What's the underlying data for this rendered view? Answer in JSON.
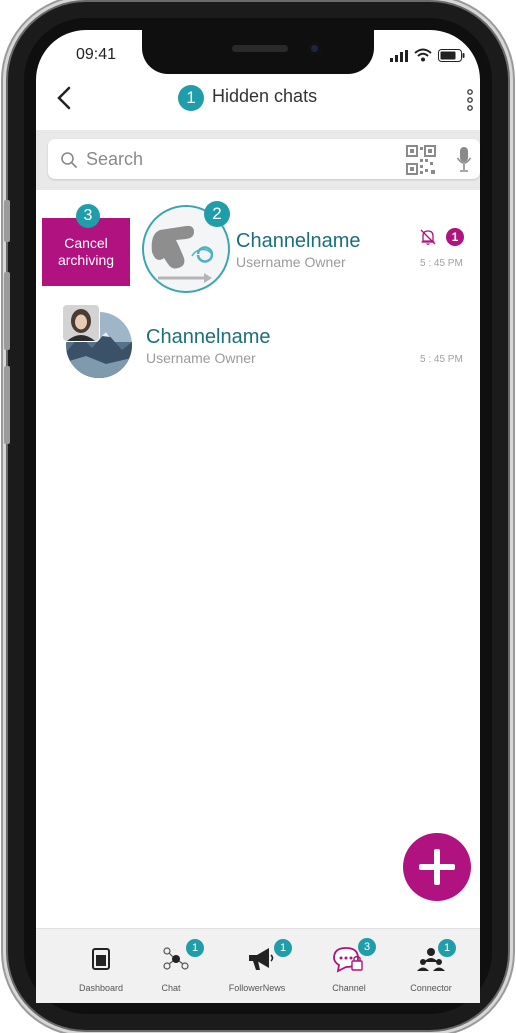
{
  "status_bar": {
    "time": "09:41"
  },
  "header": {
    "title": "Hidden chats",
    "title_badge": "1"
  },
  "search": {
    "placeholder": "Search"
  },
  "annotations": {
    "avatar_badge": "2",
    "cancel_badge": "3"
  },
  "swipe_action": {
    "label_line1": "Cancel",
    "label_line2": "archiving"
  },
  "chats": [
    {
      "name": "Channelname",
      "subtitle": "Username Owner",
      "time": "5 : 45 PM",
      "unread": "1",
      "muted": true
    },
    {
      "name": "Channelname",
      "subtitle": "Username Owner",
      "time": "5 : 45 PM"
    }
  ],
  "bottom_nav": [
    {
      "label": "Dashboard"
    },
    {
      "label": "Chat",
      "badge": "1"
    },
    {
      "label": "FollowerNews",
      "badge": "1"
    },
    {
      "label": "Channel",
      "badge": "3"
    },
    {
      "label": "Connector",
      "badge": "1"
    }
  ],
  "colors": {
    "accent": "#b0127f",
    "teal": "#1f9da8",
    "name_text": "#1c6f78"
  }
}
